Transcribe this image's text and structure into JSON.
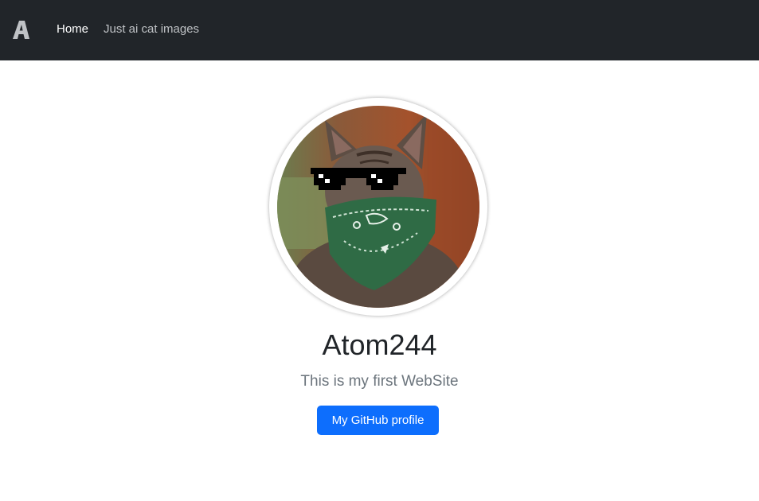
{
  "navbar": {
    "brand_logo_icon": "atom-a-logo-icon",
    "background_color": "#212529",
    "links": [
      {
        "label": "Home",
        "active": true
      },
      {
        "label": "Just ai cat images",
        "active": false
      }
    ]
  },
  "profile": {
    "avatar_icon": "cat-with-sunglasses-and-bandana-avatar",
    "name": "Atom244",
    "tagline": "This is my first WebSite",
    "button_label": "My GitHub profile",
    "button_color": "#0d6efd"
  }
}
